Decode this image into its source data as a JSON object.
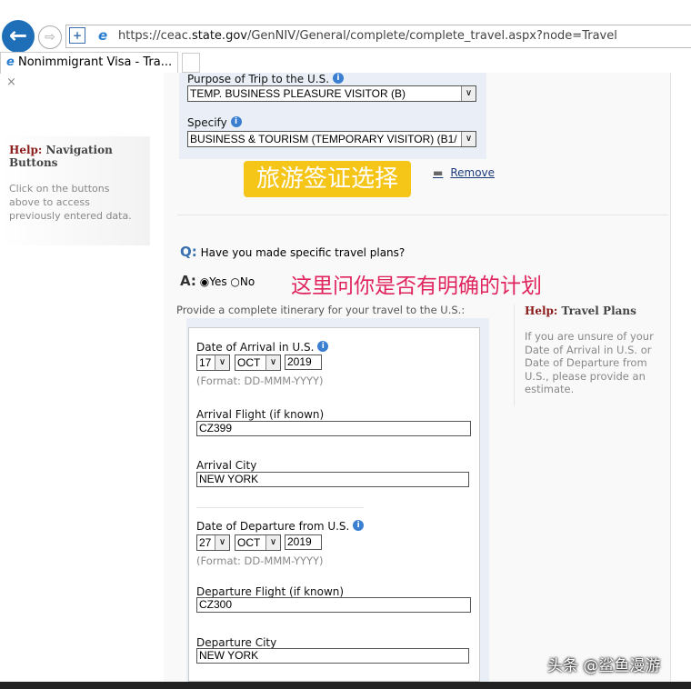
{
  "browser": {
    "url_prefix": "https://ceac.",
    "url_domain": "state.gov",
    "url_rest": "/GenNIV/General/complete/complete_travel.aspx?node=Travel",
    "tab_title": "Nonimmigrant Visa - Tra...",
    "tab_close": "×"
  },
  "left_help": {
    "label": "Help:",
    "title": "Navigation Buttons",
    "text": "Click on the buttons above to access previously entered data."
  },
  "purpose": {
    "label": "Purpose of Trip to the U.S.",
    "value": "TEMP. BUSINESS PLEASURE VISITOR (B)",
    "specify_label": "Specify",
    "specify_value": "BUSINESS & TOURISM (TEMPORARY VISITOR) (B1/"
  },
  "annotation1": "旅游签证选择",
  "remove_label": "Remove",
  "question": {
    "q": "Q:",
    "text": "Have you made specific travel plans?",
    "a": "A:",
    "yes": "Yes",
    "no": "No"
  },
  "annotation2": "这里问你是否有明确的计划",
  "itinerary_label": "Provide a complete itinerary for your travel to the U.S.:",
  "arrival": {
    "label": "Date of Arrival in U.S.",
    "day": "17",
    "month": "OCT",
    "year": "2019",
    "format": "(Format: DD-MMM-YYYY)",
    "flight_label": "Arrival Flight (if known)",
    "flight": "CZ399",
    "city_label": "Arrival City",
    "city": "NEW YORK"
  },
  "departure": {
    "label": "Date of Departure from U.S.",
    "day": "27",
    "month": "OCT",
    "year": "2019",
    "format": "(Format: DD-MMM-YYYY)",
    "flight_label": "Departure Flight (if known)",
    "flight": "CZ300",
    "city_label": "Departure City",
    "city": "NEW YORK"
  },
  "right_help": {
    "label": "Help:",
    "title": "Travel Plans",
    "text": "If you are unsure of your Date of Arrival in U.S. or Date of Departure from U.S., please provide an estimate."
  },
  "watermark": "头条 @鲨鱼漫游"
}
